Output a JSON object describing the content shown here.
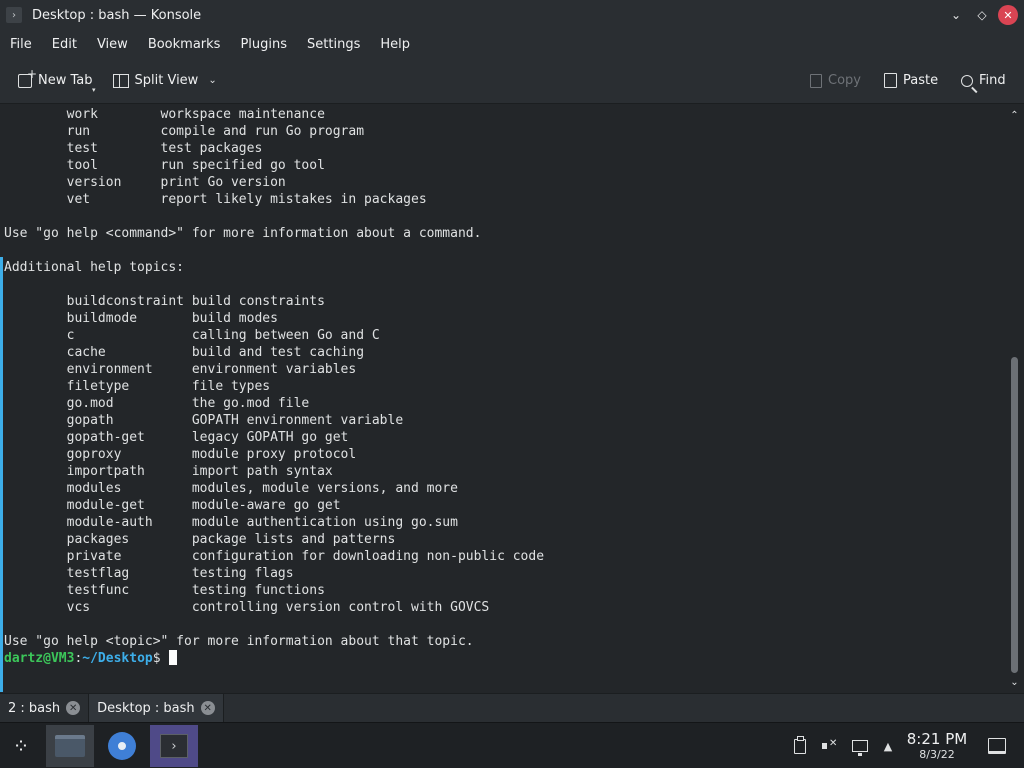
{
  "window": {
    "title": "Desktop : bash — Konsole",
    "controls": {
      "minimize": "⌄",
      "maximize": "◇",
      "close": "✕"
    }
  },
  "menu": [
    "File",
    "Edit",
    "View",
    "Bookmarks",
    "Plugins",
    "Settings",
    "Help"
  ],
  "toolbar": {
    "new_tab": "New Tab",
    "split_view": "Split View",
    "copy": "Copy",
    "paste": "Paste",
    "find": "Find"
  },
  "terminal": {
    "lines": [
      "        work        workspace maintenance",
      "        run         compile and run Go program",
      "        test        test packages",
      "        tool        run specified go tool",
      "        version     print Go version",
      "        vet         report likely mistakes in packages",
      "",
      "Use \"go help <command>\" for more information about a command.",
      "",
      "Additional help topics:",
      "",
      "        buildconstraint build constraints",
      "        buildmode       build modes",
      "        c               calling between Go and C",
      "        cache           build and test caching",
      "        environment     environment variables",
      "        filetype        file types",
      "        go.mod          the go.mod file",
      "        gopath          GOPATH environment variable",
      "        gopath-get      legacy GOPATH go get",
      "        goproxy         module proxy protocol",
      "        importpath      import path syntax",
      "        modules         modules, module versions, and more",
      "        module-get      module-aware go get",
      "        module-auth     module authentication using go.sum",
      "        packages        package lists and patterns",
      "        private         configuration for downloading non-public code",
      "        testflag        testing flags",
      "        testfunc        testing functions",
      "        vcs             controlling version control with GOVCS",
      "",
      "Use \"go help <topic>\" for more information about that topic.",
      ""
    ],
    "prompt": {
      "user_host": "dartz@VM3",
      "separator": ":",
      "path": "~/Desktop",
      "symbol": "$"
    }
  },
  "tabs": [
    {
      "label": "2 : bash",
      "active": false
    },
    {
      "label": "Desktop : bash",
      "active": true
    }
  ],
  "taskbar": {
    "clock_time": "8:21 PM",
    "clock_date": "8/3/22"
  },
  "colors": {
    "prompt_user": "#3cc65a",
    "prompt_path": "#3daee9",
    "accent": "#3daee9",
    "close_button": "#da4453"
  }
}
